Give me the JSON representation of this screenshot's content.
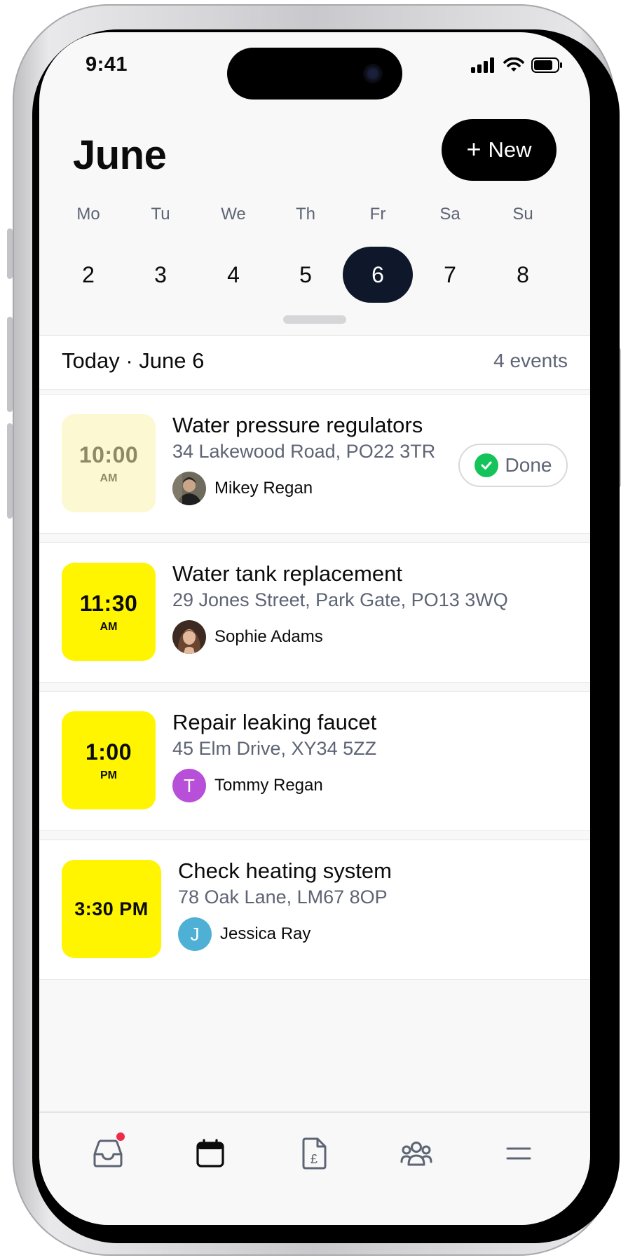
{
  "status_bar": {
    "time": "9:41"
  },
  "header": {
    "month": "June",
    "new_label": "New"
  },
  "week": {
    "days": [
      {
        "dow": "Mo",
        "num": "2"
      },
      {
        "dow": "Tu",
        "num": "3"
      },
      {
        "dow": "We",
        "num": "4"
      },
      {
        "dow": "Th",
        "num": "5"
      },
      {
        "dow": "Fr",
        "num": "6"
      },
      {
        "dow": "Sa",
        "num": "7"
      },
      {
        "dow": "Su",
        "num": "8"
      }
    ],
    "selected_index": 4
  },
  "today": {
    "title": "Today · June 6",
    "count": "4 events"
  },
  "events": [
    {
      "time": "10:00",
      "ampm": "AM",
      "title": "Water pressure regulators",
      "address": "34 Lakewood Road, PO22 3TR",
      "person": "Mikey Regan",
      "status": "Done"
    },
    {
      "time": "11:30",
      "ampm": "AM",
      "title": "Water tank replacement",
      "address": "29 Jones Street, Park Gate, PO13 3WQ",
      "person": "Sophie Adams"
    },
    {
      "time": "1:00",
      "ampm": "PM",
      "title": "Repair leaking faucet",
      "address": "45 Elm Drive, XY34 5ZZ",
      "person": "Tommy Regan",
      "avatar_letter": "T",
      "avatar_color": "#b84fd9"
    },
    {
      "time": "3:30 PM",
      "title": "Check heating system",
      "address": "78 Oak Lane, LM67 8OP",
      "person": "Jessica Ray",
      "avatar_letter": "J",
      "avatar_color": "#4fb0d6"
    }
  ],
  "colors": {
    "accent_yellow": "#fff500",
    "done_green": "#14c45a",
    "selected_day": "#0f172a"
  },
  "tabbar": {
    "items": [
      "inbox-icon",
      "calendar-icon",
      "invoice-icon",
      "people-icon",
      "menu-icon"
    ],
    "active": "calendar-icon"
  }
}
